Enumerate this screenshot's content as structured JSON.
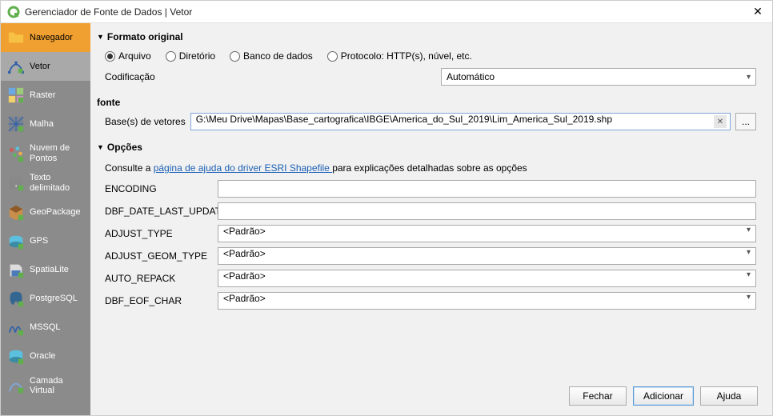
{
  "window": {
    "title": "Gerenciador de Fonte de Dados | Vetor"
  },
  "sidebar": {
    "items": [
      {
        "label": "Navegador"
      },
      {
        "label": "Vetor"
      },
      {
        "label": "Raster"
      },
      {
        "label": "Malha"
      },
      {
        "label": "Nuvem de Pontos"
      },
      {
        "label": "Texto delimitado"
      },
      {
        "label": "GeoPackage"
      },
      {
        "label": "GPS"
      },
      {
        "label": "SpatiaLite"
      },
      {
        "label": "PostgreSQL"
      },
      {
        "label": "MSSQL"
      },
      {
        "label": "Oracle"
      },
      {
        "label": "Camada Virtual"
      }
    ]
  },
  "sections": {
    "source_format": "Formato original",
    "source": "fonte",
    "options": "Opções"
  },
  "source_type": {
    "file": "Arquivo",
    "directory": "Diretório",
    "database": "Banco de dados",
    "protocol": "Protocolo: HTTP(s), núvel, etc.",
    "selected": "file"
  },
  "encoding": {
    "label": "Codificação",
    "value": "Automático"
  },
  "vector_dataset": {
    "label": "Base(s) de vetores",
    "value": "G:\\Meu Drive\\Mapas\\Base_cartografica\\IBGE\\America_do_Sul_2019\\Lim_America_Sul_2019.shp",
    "browse": "..."
  },
  "help_line": {
    "prefix": "Consulte a ",
    "link": "página de ajuda do driver ESRI Shapefile ",
    "suffix": "para explicações detalhadas sobre as opções"
  },
  "options": [
    {
      "name": "ENCODING",
      "type": "text",
      "value": ""
    },
    {
      "name": "DBF_DATE_LAST_UPDATE",
      "type": "text",
      "value": ""
    },
    {
      "name": "ADJUST_TYPE",
      "type": "select",
      "value": "<Padrão>"
    },
    {
      "name": "ADJUST_GEOM_TYPE",
      "type": "select",
      "value": "<Padrão>"
    },
    {
      "name": "AUTO_REPACK",
      "type": "select",
      "value": "<Padrão>"
    },
    {
      "name": "DBF_EOF_CHAR",
      "type": "select",
      "value": "<Padrão>"
    }
  ],
  "footer": {
    "close": "Fechar",
    "add": "Adicionar",
    "help": "Ajuda"
  }
}
